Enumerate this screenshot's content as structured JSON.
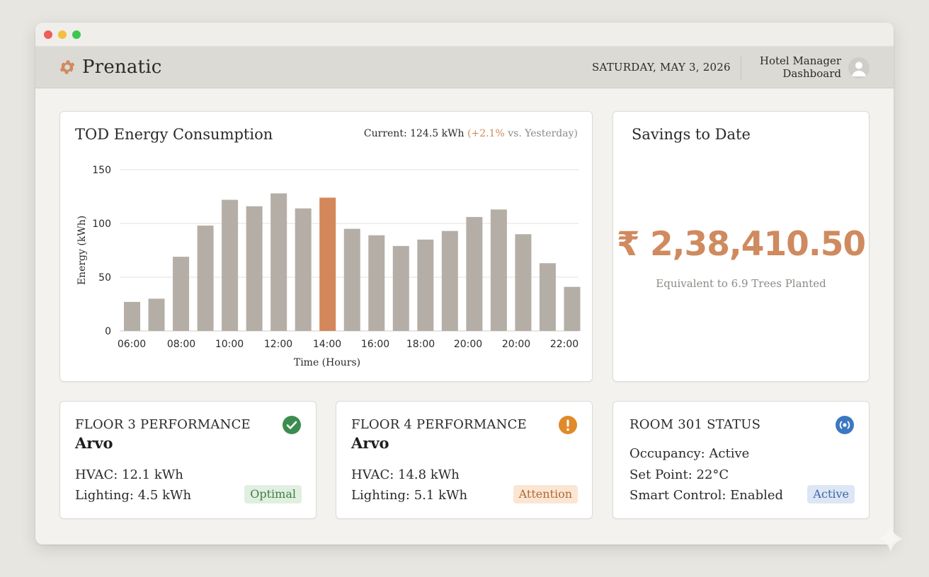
{
  "app": {
    "brand_name": "Prenatic",
    "date": "SATURDAY, MAY 3, 2026",
    "user_role_line1": "Hotel Manager",
    "user_role_line2": "Dashboard"
  },
  "energy_card": {
    "title": "TOD Energy Consumption",
    "current_label": "Current: 124.5 kWh",
    "delta": "(+2.1%",
    "vs": "vs. Yesterday)"
  },
  "chart_data": {
    "type": "bar",
    "xlabel": "Time (Hours)",
    "ylabel": "Energy (kWh)",
    "ylim": [
      0,
      150
    ],
    "yticks": [
      0,
      50,
      100,
      150
    ],
    "xtick_labels": [
      "06:00",
      "08:00",
      "10:00",
      "12:00",
      "14:00",
      "16:00",
      "18:00",
      "20:00",
      "20:00",
      "22:00"
    ],
    "values": [
      27,
      30,
      69,
      98,
      122,
      116,
      128,
      114,
      124,
      95,
      89,
      79,
      85,
      93,
      106,
      113,
      90,
      63,
      41
    ],
    "highlight_index": 8,
    "bar_color": "#b4aea6",
    "highlight_color": "#d4875a",
    "grid": true
  },
  "savings_card": {
    "title": "Savings to Date",
    "amount": "₹ 2,38,410.50",
    "subtitle": "Equivalent to 6.9 Trees Planted"
  },
  "floor3": {
    "title": "FLOOR 3 PERFORMANCE",
    "subtitle": "Arvo",
    "hvac": "HVAC: 12.1 kWh",
    "lighting": "Lighting: 4.5 kWh",
    "badge": "Optimal",
    "icon": "check-circle-icon"
  },
  "floor4": {
    "title": "FLOOR 4 PERFORMANCE",
    "subtitle": "Arvo",
    "hvac": "HVAC: 14.8 kWh",
    "lighting": "Lighting: 5.1 kWh",
    "badge": "Attention",
    "icon": "alert-circle-icon"
  },
  "room301": {
    "title": "ROOM 301 STATUS",
    "occupancy": "Occupancy: Active",
    "set_point": "Set Point: 22°C",
    "smart_control": "Smart Control: Enabled",
    "badge": "Active",
    "icon": "broadcast-icon"
  },
  "colors": {
    "accent": "#cf8a5f",
    "success": "#3d8c4f",
    "warning": "#e08a2a",
    "info": "#3a78c2"
  }
}
